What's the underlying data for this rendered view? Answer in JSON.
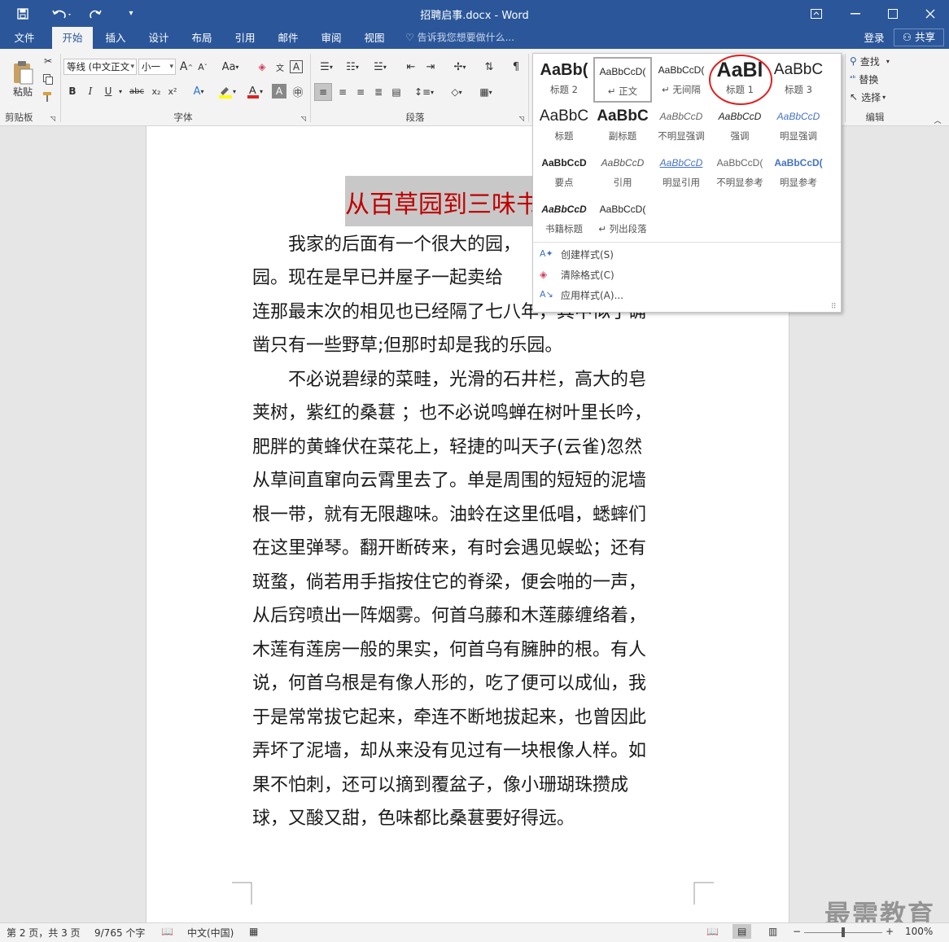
{
  "window": {
    "title": "招聘启事.docx - Word"
  },
  "tabs": [
    {
      "label": "文件"
    },
    {
      "label": "开始"
    },
    {
      "label": "插入"
    },
    {
      "label": "设计"
    },
    {
      "label": "布局"
    },
    {
      "label": "引用"
    },
    {
      "label": "邮件"
    },
    {
      "label": "审阅"
    },
    {
      "label": "视图"
    }
  ],
  "tell_me": "告诉我您想要做什么...",
  "account": {
    "login": "登录",
    "share": "共享"
  },
  "clipboard": {
    "paste": "粘贴",
    "label": "剪贴板"
  },
  "font": {
    "name": "等线 (中文正文",
    "size": "小一",
    "label": "字体",
    "grow": "A",
    "shrink": "A",
    "case": "Aa",
    "bold": "B",
    "italic": "I",
    "underline": "U",
    "strike": "abc"
  },
  "paragraph": {
    "label": "段落"
  },
  "editing": {
    "find": "查找",
    "replace": "替换",
    "select": "选择",
    "label": "编辑"
  },
  "styles": [
    {
      "preview": "AaBb(",
      "name": "标题 2"
    },
    {
      "preview": "AaBbCcD(",
      "name": "↵ 正文"
    },
    {
      "preview": "AaBbCcD(",
      "name": "↵ 无间隔"
    },
    {
      "preview": "AaBl",
      "name": "标题 1"
    },
    {
      "preview": "AaBbC",
      "name": "标题 3"
    },
    {
      "preview": "AaBbC",
      "name": "标题"
    },
    {
      "preview": "AaBbC",
      "name": "副标题"
    },
    {
      "preview": "AaBbCcD",
      "name": "不明显强调"
    },
    {
      "preview": "AaBbCcD",
      "name": "强调"
    },
    {
      "preview": "AaBbCcD",
      "name": "明显强调"
    },
    {
      "preview": "AaBbCcD",
      "name": "要点"
    },
    {
      "preview": "AaBbCcD",
      "name": "引用"
    },
    {
      "preview": "AaBbCcD",
      "name": "明显引用"
    },
    {
      "preview": "AaBbCcD(",
      "name": "不明显参考"
    },
    {
      "preview": "AaBbCcD(",
      "name": "明显参考"
    },
    {
      "preview": "AaBbCcD",
      "name": "书籍标题"
    },
    {
      "preview": "AaBbCcD(",
      "name": "↵ 列出段落"
    }
  ],
  "gallery_menu": [
    {
      "label": "创建样式(S)"
    },
    {
      "label": "清除格式(C)"
    },
    {
      "label": "应用样式(A)..."
    }
  ],
  "document": {
    "title": "从百草园到三味书屋",
    "lines": [
      "　　我家的后面有一个很大的园，",
      "园。现在是早已并屋子一起卖给",
      "连那最末次的相见也已经隔了七八年，其中似乎确",
      "凿只有一些野草;但那时却是我的乐园。",
      "　　不必说碧绿的菜畦，光滑的石井栏，高大的皂",
      "荚树，紫红的桑葚 ；也不必说鸣蝉在树叶里长吟，",
      "肥胖的黄蜂伏在菜花上，轻捷的叫天子(云雀)忽然",
      "从草间直窜向云霄里去了。单是周围的短短的泥墙",
      "根一带，就有无限趣味。油蛉在这里低唱，蟋蟀们",
      "在这里弹琴。翻开断砖来，有时会遇见蜈蚣；还有",
      "斑蝥，倘若用手指按住它的脊梁，便会啪的一声，",
      "从后窍喷出一阵烟雾。何首乌藤和木莲藤缠络着，",
      "木莲有莲房一般的果实，何首乌有臃肿的根。有人",
      "说，何首乌根是有像人形的，吃了便可以成仙，我",
      "于是常常拔它起来，牵连不断地拔起来，也曾因此",
      "弄坏了泥墙，却从来没有见过有一块根像人样。如",
      "果不怕刺，还可以摘到覆盆子，像小珊瑚珠攒成",
      "球，又酸又甜，色味都比桑葚要好得远。"
    ]
  },
  "status": {
    "page": "第 2 页，共 3 页",
    "words": "9/765 个字",
    "lang": "中文(中国)",
    "zoom": "100%"
  },
  "watermark": "最需教育",
  "colors": {
    "accent": "#2b579a",
    "title_red": "#c00000",
    "highlight": "#c8c8c8",
    "circle": "#e02020"
  }
}
